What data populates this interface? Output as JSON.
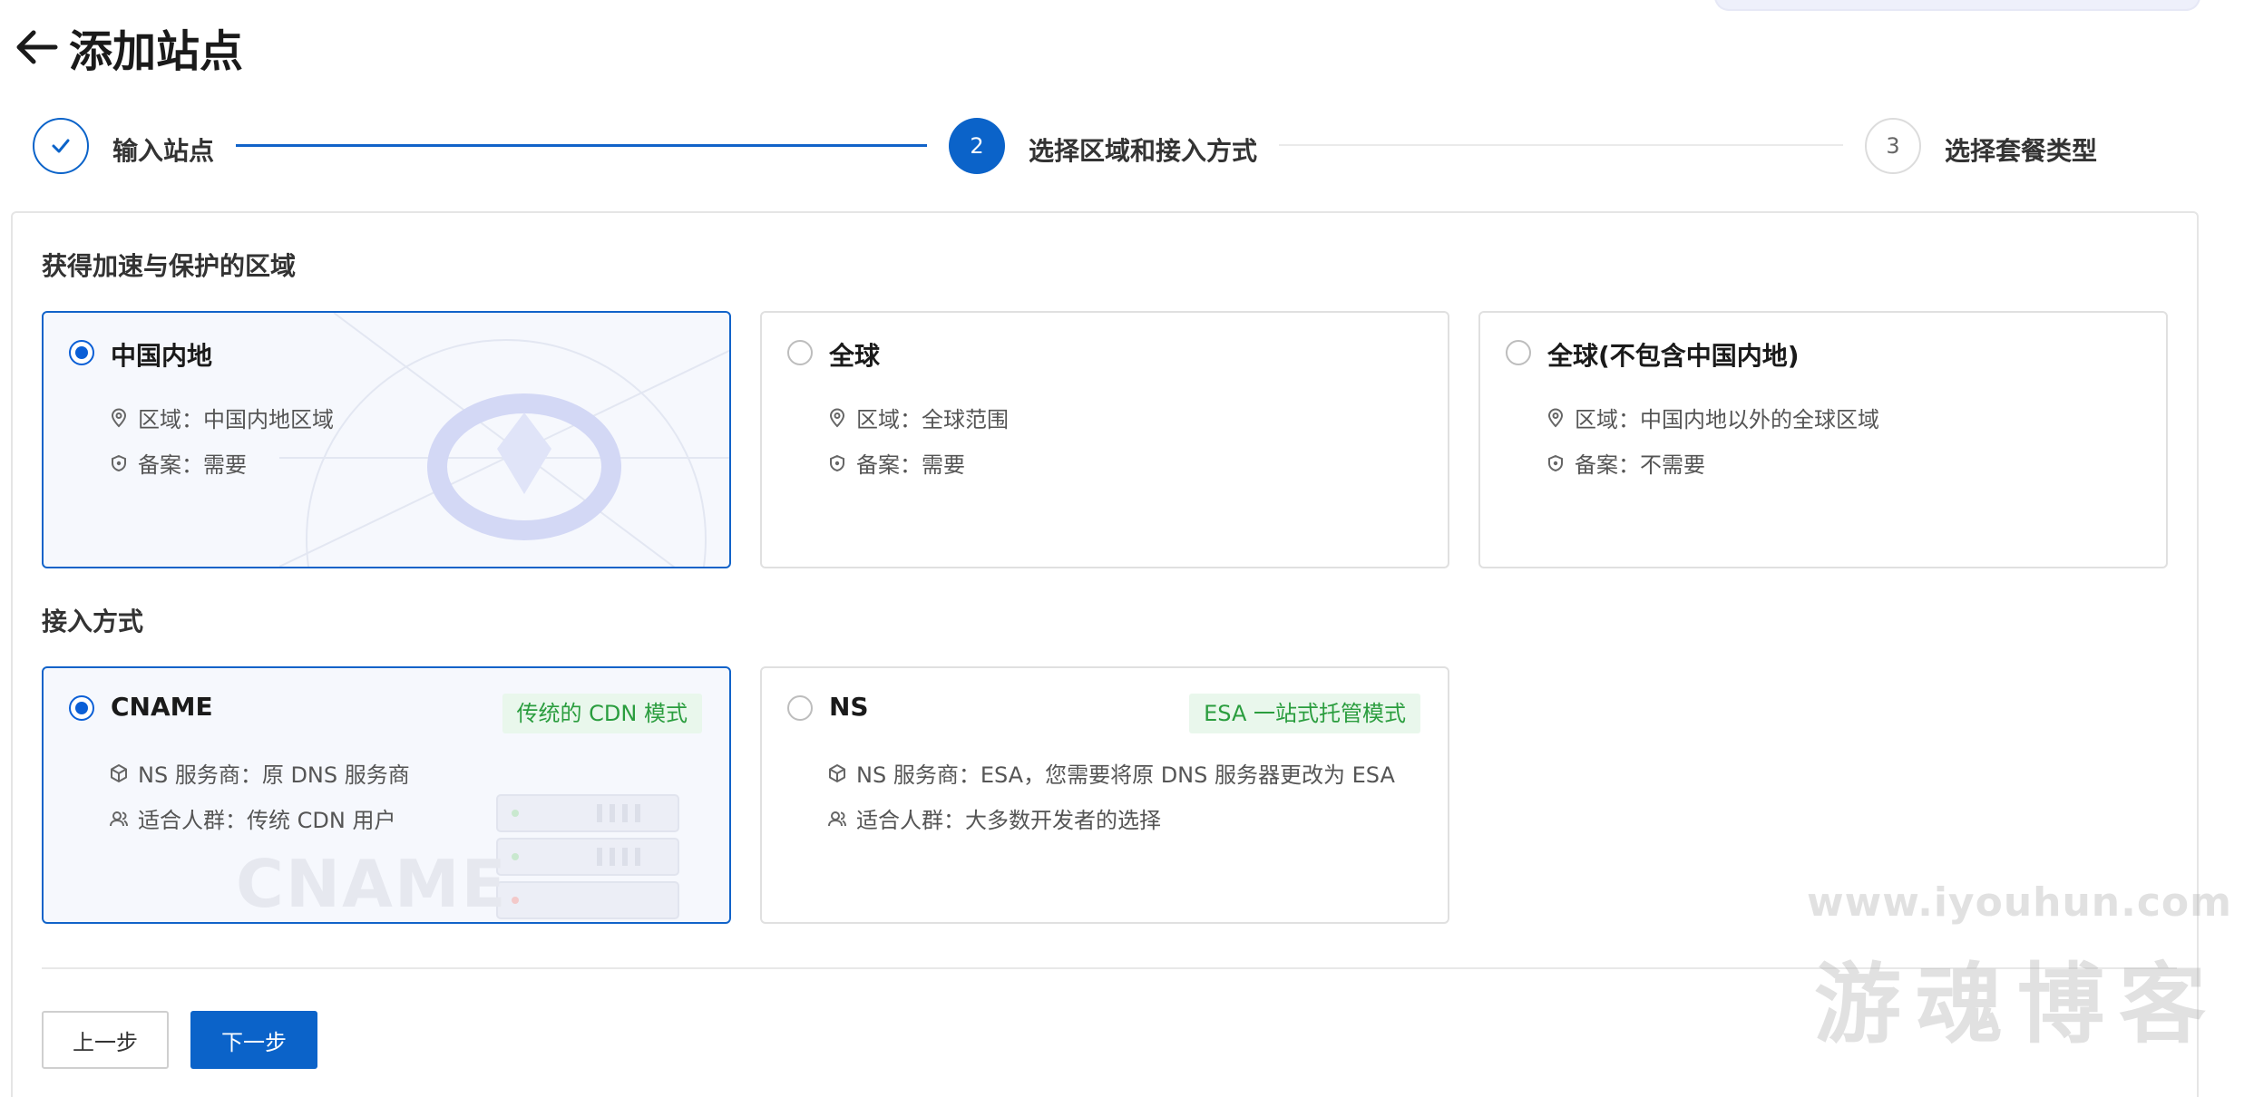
{
  "header": {
    "title": "添加站点"
  },
  "steps": [
    {
      "number": "1",
      "label": "输入站点",
      "state": "done"
    },
    {
      "number": "2",
      "label": "选择区域和接入方式",
      "state": "active"
    },
    {
      "number": "3",
      "label": "选择套餐类型",
      "state": "pending"
    }
  ],
  "region": {
    "title": "获得加速与保护的区域",
    "selected": "中国内地",
    "options": [
      {
        "name": "中国内地",
        "area": "区域：中国内地区域",
        "record": "备案：需要"
      },
      {
        "name": "全球",
        "area": "区域：全球范围",
        "record": "备案：需要"
      },
      {
        "name": "全球(不包含中国内地)",
        "area": "区域：中国内地以外的全球区域",
        "record": "备案：不需要"
      }
    ]
  },
  "access": {
    "title": "接入方式",
    "selected": "CNAME",
    "options": [
      {
        "name": "CNAME",
        "tag": "传统的 CDN 模式",
        "provider": "NS 服务商：原 DNS 服务商",
        "audience": "适合人群：传统 CDN 用户",
        "decoration_text": "CNAME"
      },
      {
        "name": "NS",
        "tag": "ESA 一站式托管模式",
        "provider": "NS 服务商：ESA，您需要将原 DNS 服务器更改为 ESA",
        "audience": "适合人群：大多数开发者的选择"
      }
    ]
  },
  "buttons": {
    "prev": "上一步",
    "next": "下一步"
  },
  "watermark": {
    "url": "www.iyouhun.com",
    "name": "游魂博客"
  },
  "colors": {
    "primary": "#0b63c9",
    "tag_bg": "#e9f7ec",
    "tag_text": "#2a9d3e",
    "selected_border": "#1163c9"
  },
  "icons": {
    "back": "arrow-left-icon",
    "done": "check-icon",
    "area": "location-pin-icon",
    "record": "shield-icon",
    "provider": "cube-icon",
    "audience": "users-icon"
  }
}
